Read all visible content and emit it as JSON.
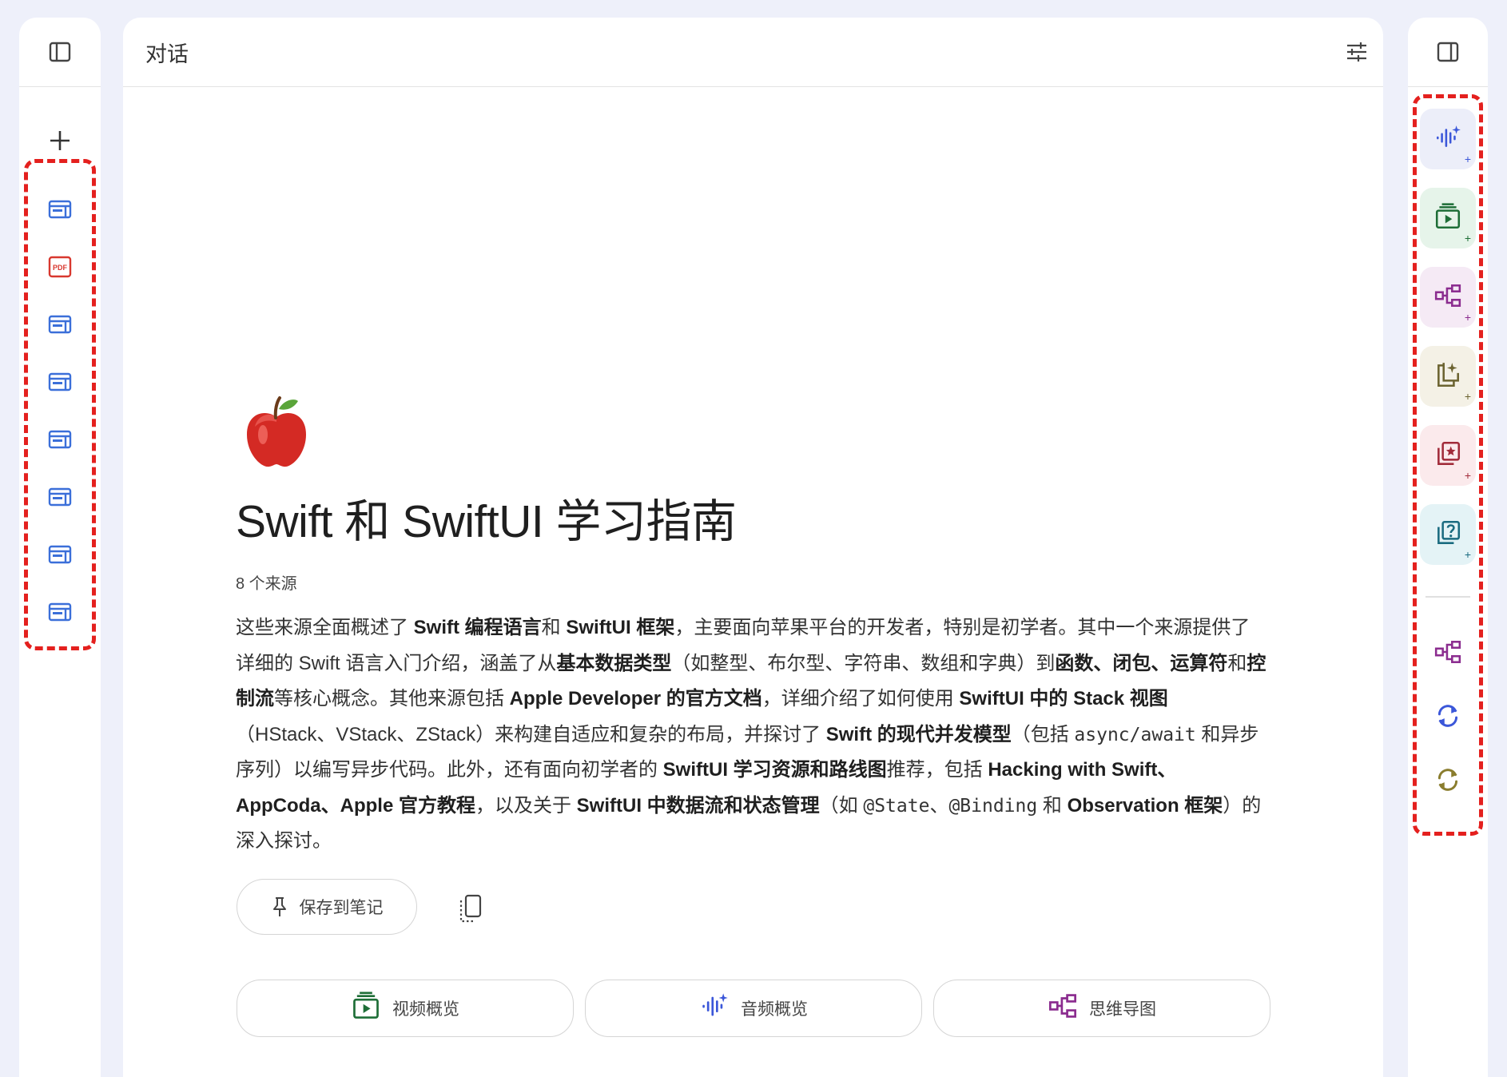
{
  "header": {
    "title": "对话"
  },
  "notebook": {
    "emoji": "🍎",
    "title": "Swift 和 SwiftUI 学习指南",
    "source_count": "8 个来源",
    "summary": [
      {
        "t": "这些来源全面概述了 "
      },
      {
        "t": "Swift 编程语言",
        "b": true
      },
      {
        "t": "和 "
      },
      {
        "t": "SwiftUI 框架",
        "b": true
      },
      {
        "t": "，主要面向苹果平台的开发者，特别是初学者。其中一个来源提供了详细的 Swift 语言入门介绍，涵盖了从"
      },
      {
        "t": "基本数据类型",
        "b": true
      },
      {
        "t": "（如整型、布尔型、字符串、数组和字典）到"
      },
      {
        "t": "函数、闭包、运算符",
        "b": true
      },
      {
        "t": "和"
      },
      {
        "t": "控制流",
        "b": true
      },
      {
        "t": "等核心概念。其他来源包括 "
      },
      {
        "t": "Apple Developer 的官方文档",
        "b": true
      },
      {
        "t": "，详细介绍了如何使用 "
      },
      {
        "t": "SwiftUI 中的 Stack 视图",
        "b": true
      },
      {
        "t": "（HStack、VStack、ZStack）来构建自适应和复杂的布局，并探讨了 "
      },
      {
        "t": "Swift 的现代并发模型",
        "b": true
      },
      {
        "t": "（包括 "
      },
      {
        "t": "async/await",
        "m": true
      },
      {
        "t": " 和异步序列）以编写异步代码。此外，还有面向初学者的 "
      },
      {
        "t": "SwiftUI 学习资源和路线图",
        "b": true
      },
      {
        "t": "推荐，包括 "
      },
      {
        "t": "Hacking with Swift、AppCoda、Apple 官方教程",
        "b": true
      },
      {
        "t": "，以及关于 "
      },
      {
        "t": "SwiftUI 中数据流和状态管理",
        "b": true
      },
      {
        "t": "（如 "
      },
      {
        "t": "@State",
        "m": true
      },
      {
        "t": "、"
      },
      {
        "t": "@Binding",
        "m": true
      },
      {
        "t": " 和 "
      },
      {
        "t": "Observation 框架",
        "b": true
      },
      {
        "t": "）的深入探讨。"
      }
    ],
    "save_label": "保存到笔记",
    "actions": [
      {
        "name": "video-overview-button",
        "label": "视频概览",
        "icon": "video-overview-icon"
      },
      {
        "name": "audio-overview-button",
        "label": "音频概览",
        "icon": "audio-overview-icon"
      },
      {
        "name": "mind-map-button",
        "label": "思维导图",
        "icon": "mind-map-icon"
      }
    ]
  },
  "sources": [
    "web",
    "pdf",
    "web",
    "web",
    "web",
    "web",
    "web",
    "web"
  ],
  "studio": [
    {
      "name": "audio-overview",
      "icon": "audio-overview-icon",
      "bg": "#eceef9",
      "color": "#3b57d9"
    },
    {
      "name": "video-overview",
      "icon": "video-overview-icon",
      "bg": "#e6f4ea",
      "color": "#1e6e37"
    },
    {
      "name": "mind-map",
      "icon": "mind-map-icon",
      "bg": "#f5eaf5",
      "color": "#8b2c8f"
    },
    {
      "name": "reports",
      "icon": "reports-icon",
      "bg": "#f4f1e6",
      "color": "#6b6330"
    },
    {
      "name": "flashcards",
      "icon": "flashcards-icon",
      "bg": "#fbeaec",
      "color": "#a12b3a"
    },
    {
      "name": "quiz",
      "icon": "quiz-icon",
      "bg": "#e4f3f6",
      "color": "#1a6b80"
    }
  ],
  "tools": [
    {
      "name": "mind-map-item",
      "icon": "mind-map-icon",
      "color": "#8b2c8f"
    },
    {
      "name": "refresh-item",
      "icon": "refresh-icon",
      "color": "#3b57d9"
    },
    {
      "name": "refresh-item",
      "icon": "refresh-icon",
      "color": "#8a7d2e"
    }
  ],
  "colors": {
    "accent_red_dash": "#e4201e",
    "web_icon": "#3b6fd9",
    "pdf_icon": "#d8382f"
  }
}
